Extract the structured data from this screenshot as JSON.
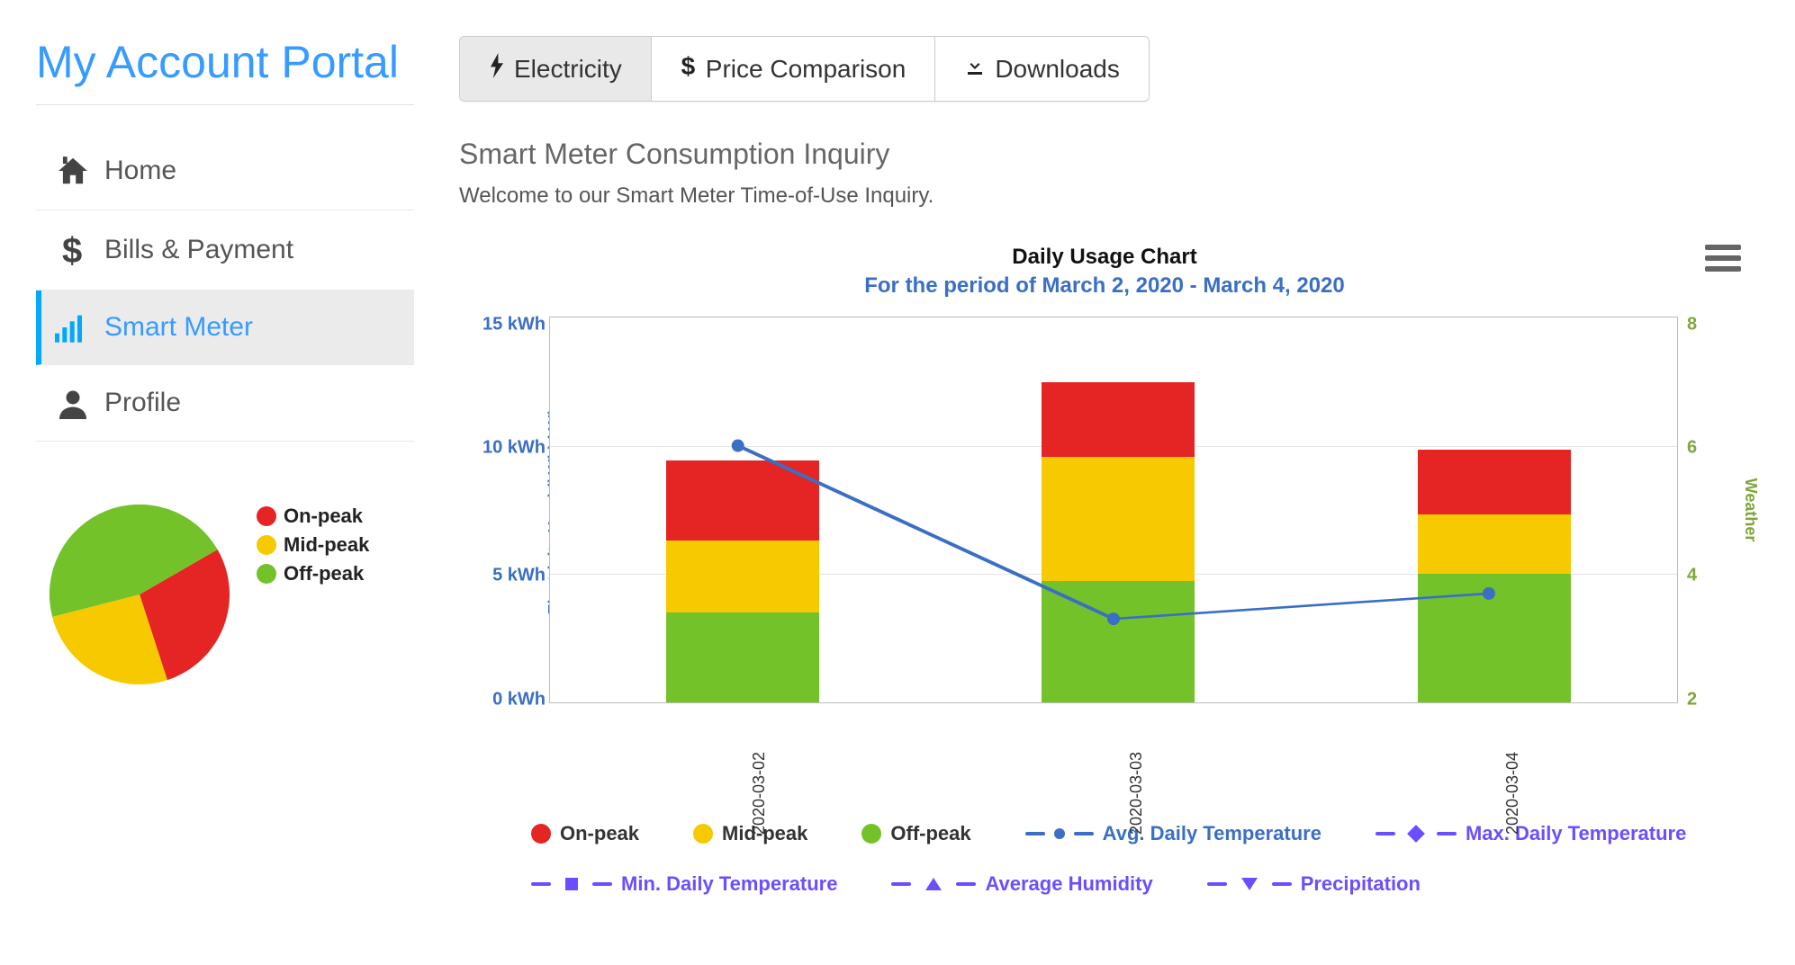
{
  "portal": {
    "title": "My Account Portal"
  },
  "nav": {
    "home": "Home",
    "bills": "Bills & Payment",
    "smart_meter": "Smart Meter",
    "profile": "Profile"
  },
  "pie_legend": {
    "on_peak": "On-peak",
    "mid_peak": "Mid-peak",
    "off_peak": "Off-peak"
  },
  "tabs": {
    "electricity": "Electricity",
    "price_comparison": "Price Comparison",
    "downloads": "Downloads"
  },
  "section": {
    "title": "Smart Meter Consumption Inquiry",
    "welcome": "Welcome to our Smart Meter Time-of-Use Inquiry."
  },
  "chart_header": {
    "title": "Daily Usage Chart",
    "subtitle": "For the period of March 2, 2020 - March 4, 2020"
  },
  "axes": {
    "y_left_label": "Electricity Used (kWh) kWh",
    "y_right_label": "Weather",
    "ticks_left": {
      "t0": "0 kWh",
      "t5": "5 kWh",
      "t10": "10 kWh",
      "t15": "15 kWh"
    },
    "ticks_right": {
      "r2": "2",
      "r4": "4",
      "r6": "6",
      "r8": "8"
    },
    "xcats": {
      "c0": "2020-03-02",
      "c1": "2020-03-03",
      "c2": "2020-03-04"
    }
  },
  "legend": {
    "on_peak": "On-peak",
    "mid_peak": "Mid-peak",
    "off_peak": "Off-peak",
    "avg_temp": "Avg. Daily Temperature",
    "max_temp": "Max. Daily Temperature",
    "min_temp": "Min. Daily Temperature",
    "avg_humidity": "Average Humidity",
    "precip": "Precipitation"
  },
  "colors": {
    "on_peak": "#e52424",
    "mid_peak": "#f6c900",
    "off_peak": "#74c22a",
    "temp_line": "#3a6fc4",
    "purple": "#6a4fff"
  },
  "chart_data": {
    "type": "bar",
    "title": "Daily Usage Chart",
    "subtitle": "For the period of March 2, 2020 - March 4, 2020",
    "xlabel": "",
    "ylabel": "Electricity Used (kWh) kWh",
    "ylim": [
      0,
      15
    ],
    "y2label": "Weather",
    "y2lim": [
      2,
      8
    ],
    "categories": [
      "2020-03-02",
      "2020-03-03",
      "2020-03-04"
    ],
    "series": [
      {
        "name": "Off-peak",
        "values": [
          3.5,
          4.7,
          5.0
        ],
        "stack": "usage",
        "color": "#74c22a"
      },
      {
        "name": "Mid-peak",
        "values": [
          2.8,
          4.8,
          2.3
        ],
        "stack": "usage",
        "color": "#f6c900"
      },
      {
        "name": "On-peak",
        "values": [
          3.1,
          2.9,
          2.5
        ],
        "stack": "usage",
        "color": "#e52424"
      },
      {
        "name": "Avg. Daily Temperature",
        "type": "line",
        "axis": "y2",
        "values": [
          6.0,
          3.3,
          3.7
        ],
        "color": "#3a6fc4"
      }
    ],
    "pie": {
      "type": "pie",
      "slices": [
        {
          "name": "On-peak",
          "value": 27,
          "color": "#e52424"
        },
        {
          "name": "Mid-peak",
          "value": 31,
          "color": "#f6c900"
        },
        {
          "name": "Off-peak",
          "value": 42,
          "color": "#74c22a"
        }
      ]
    }
  }
}
